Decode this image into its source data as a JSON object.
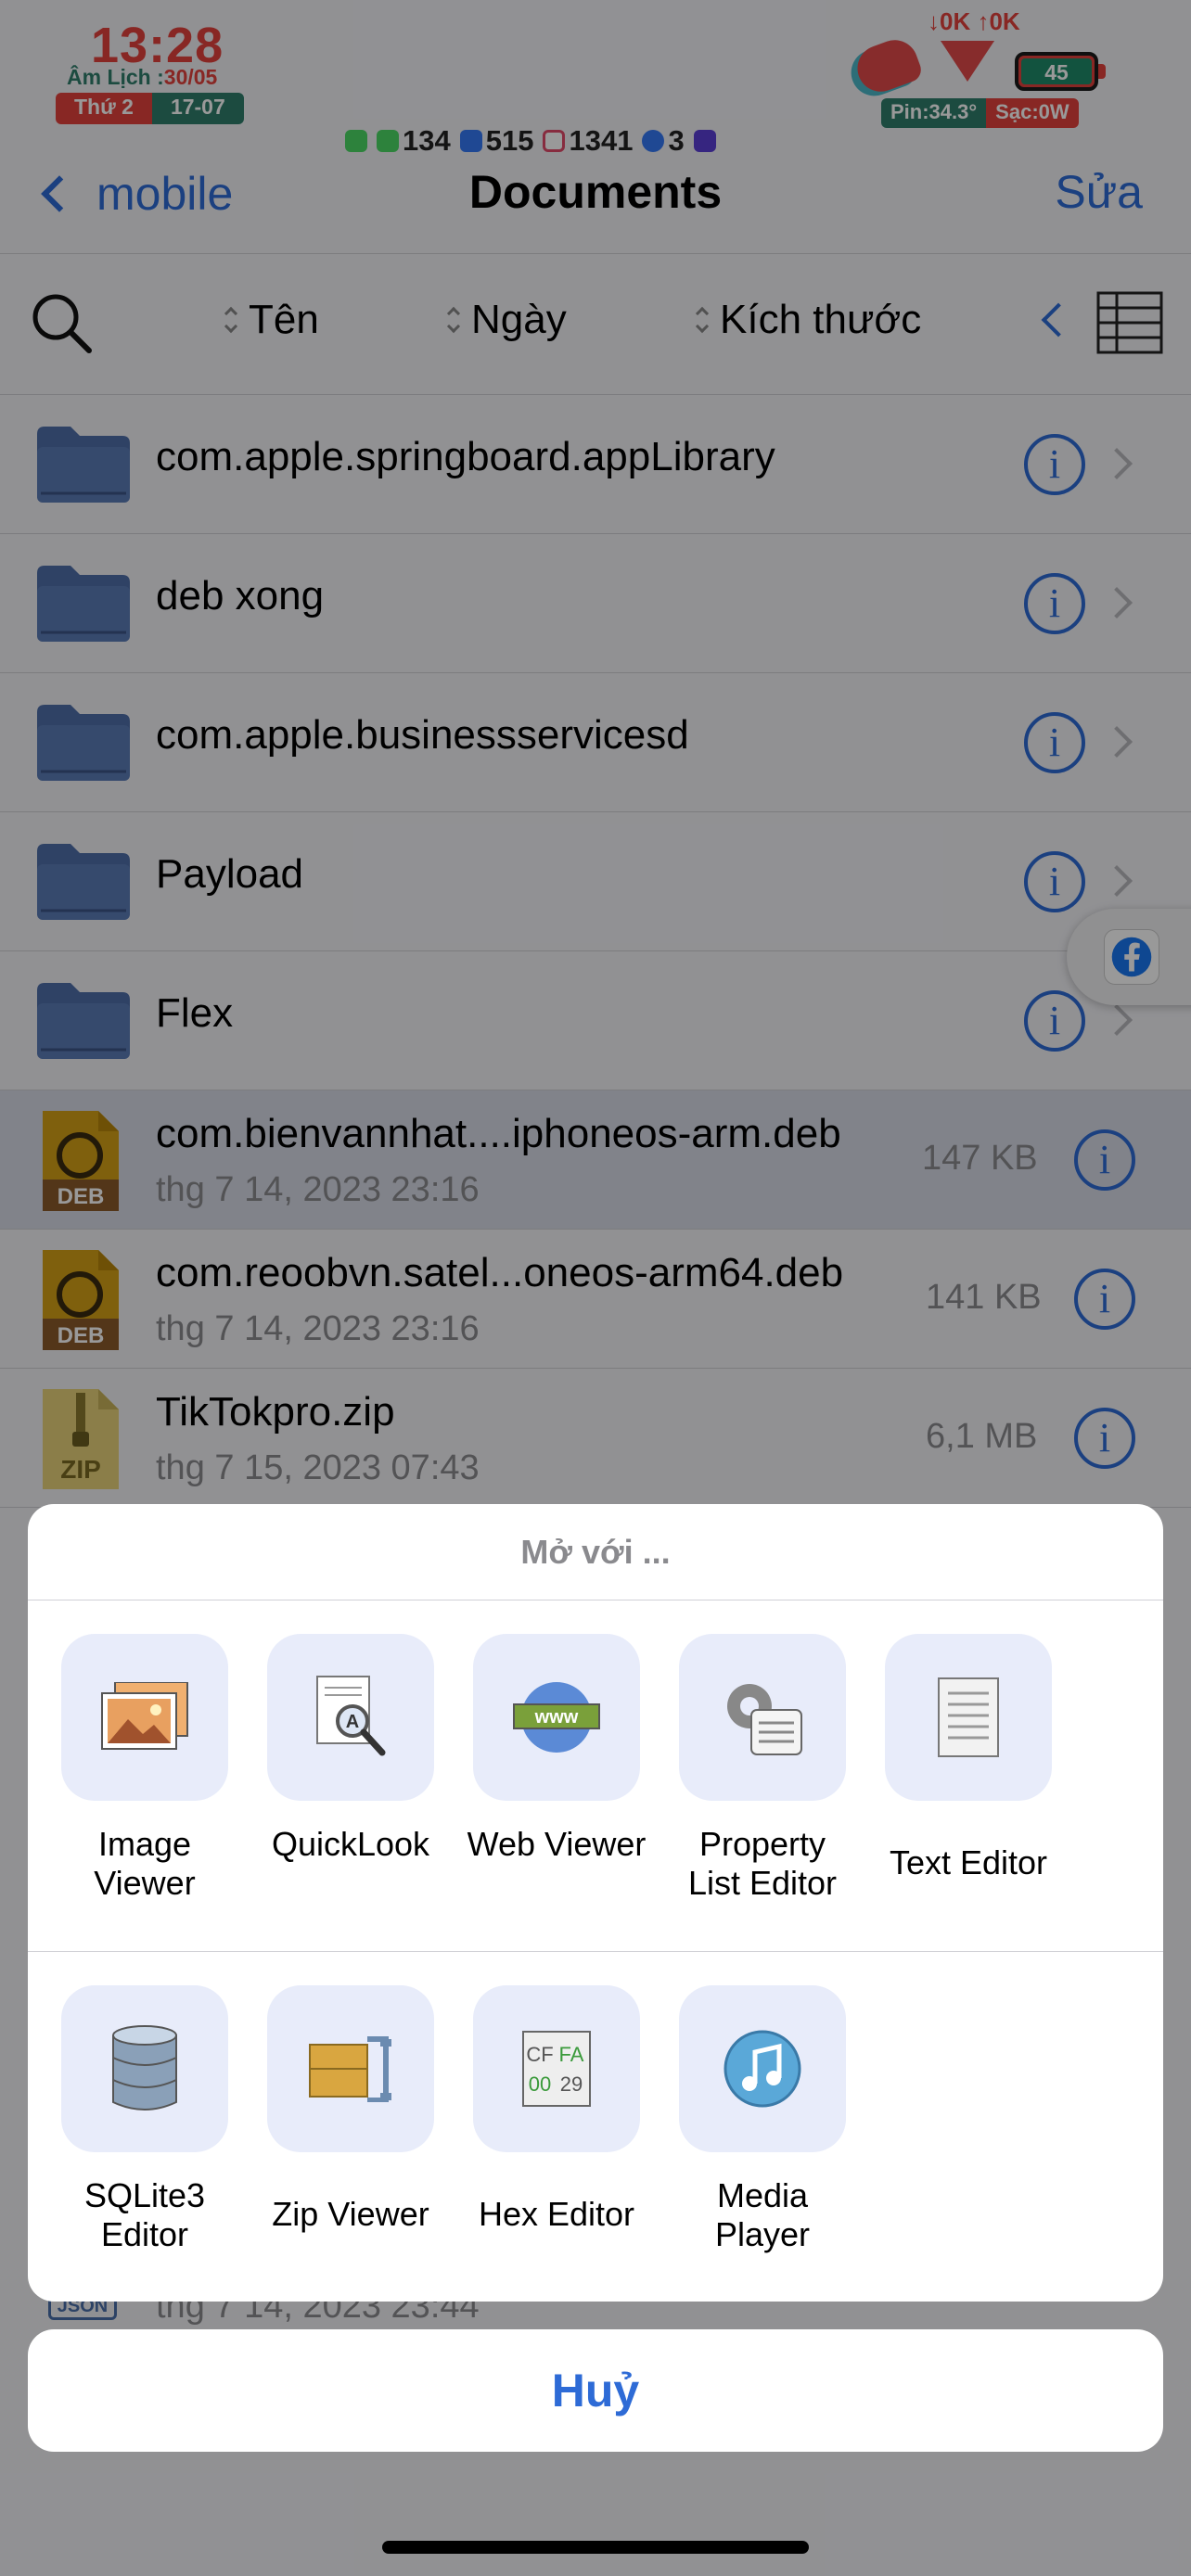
{
  "status": {
    "time": "13:28",
    "lunar_label": "Âm Lịch :",
    "lunar_value": "30/05",
    "weekday": "Thứ 2",
    "date": "17-07",
    "network": "↓0K ↑0K",
    "battery": "45",
    "pin_temp": "Pin:34.3°",
    "charge": "Sạc:0W",
    "notifications": [
      {
        "icon": "phone-icon",
        "count": "",
        "color": "#4cd964"
      },
      {
        "icon": "messages-icon",
        "count": "134",
        "color": "#4cd964"
      },
      {
        "icon": "contacts-icon",
        "count": "515",
        "color": "#3478f6"
      },
      {
        "icon": "mail-icon",
        "count": "1341",
        "color": "#e24a6a"
      },
      {
        "icon": "messenger-icon",
        "count": "3",
        "color": "#3478f6"
      },
      {
        "icon": "star-app-icon",
        "count": "",
        "color": "#5a3fd6"
      }
    ]
  },
  "nav": {
    "back_label": "mobile",
    "title": "Documents",
    "edit_label": "Sửa"
  },
  "sort": {
    "name": "Tên",
    "date": "Ngày",
    "size": "Kích thước"
  },
  "files": [
    {
      "type": "folder",
      "name": "com.apple.springboard.appLibrary"
    },
    {
      "type": "folder",
      "name": "deb xong"
    },
    {
      "type": "folder",
      "name": "com.apple.businessservicesd"
    },
    {
      "type": "folder",
      "name": "Payload"
    },
    {
      "type": "folder",
      "name": "Flex"
    },
    {
      "type": "deb",
      "name": "com.bienvannhat....iphoneos-arm.deb",
      "date": "thg 7 14, 2023 23:16",
      "size": "147 KB",
      "badge": "DEB"
    },
    {
      "type": "deb",
      "name": "com.reoobvn.satel...oneos-arm64.deb",
      "date": "thg 7 14, 2023 23:16",
      "size": "141 KB",
      "badge": "DEB"
    },
    {
      "type": "zip",
      "name": "TikTokpro.zip",
      "date": "thg 7 15, 2023 07:43",
      "size": "6,1 MB",
      "badge": "ZIP"
    },
    {
      "type": "json",
      "name": "",
      "date": "thg 7 14, 2023 23:44",
      "size": "",
      "badge": "JSON"
    }
  ],
  "sheet": {
    "title": "Mở với ...",
    "apps_row1": [
      {
        "icon": "image-viewer-icon",
        "label": "Image Viewer"
      },
      {
        "icon": "quicklook-icon",
        "label": "QuickLook"
      },
      {
        "icon": "web-viewer-icon",
        "label": "Web Viewer"
      },
      {
        "icon": "property-list-icon",
        "label": "Property List Editor"
      },
      {
        "icon": "text-editor-icon",
        "label": "Text Editor"
      }
    ],
    "apps_row2": [
      {
        "icon": "sqlite-icon",
        "label": "SQLite3 Editor"
      },
      {
        "icon": "zip-viewer-icon",
        "label": "Zip Viewer"
      },
      {
        "icon": "hex-editor-icon",
        "label": "Hex Editor"
      },
      {
        "icon": "media-player-icon",
        "label": "Media Player"
      }
    ],
    "hex_icon_text": [
      "CF",
      "FA",
      "00",
      "29"
    ],
    "www_text": "www",
    "quicklook_letter": "A",
    "cancel_label": "Huỷ"
  },
  "colors": {
    "accent": "#2e6bd6",
    "folder": "#4f6fa8",
    "clock_red": "#e3423c",
    "clock_green": "#2f7d6b"
  }
}
